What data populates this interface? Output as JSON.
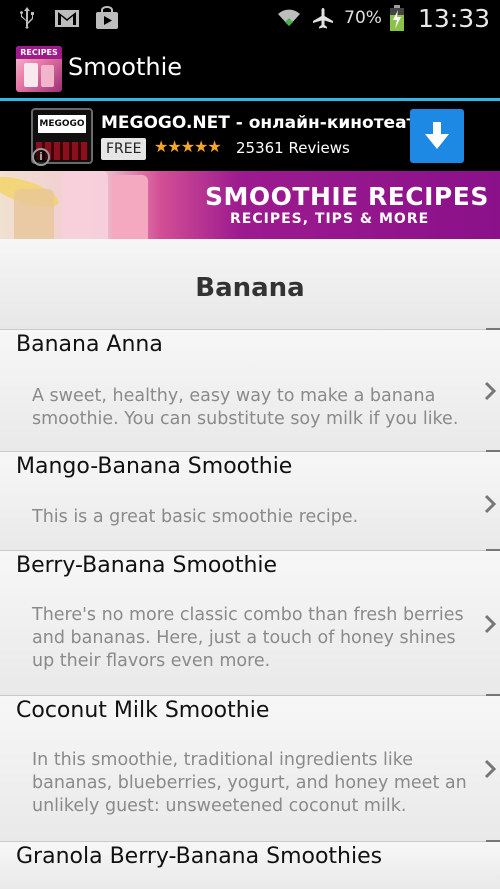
{
  "status_bar": {
    "battery_percent": "70%",
    "time": "13:33",
    "icons": [
      "usb-icon",
      "gmail-icon",
      "play-store-icon",
      "wifi-icon",
      "airplane-icon",
      "battery-charging-icon"
    ]
  },
  "action_bar": {
    "app_icon_tag": "RECIPES",
    "title": "Smoothie"
  },
  "ad": {
    "logo_text": "MEGOGO",
    "title": "MEGOGO.NET - онлайн-кинотеатр",
    "price": "FREE",
    "rating_stars": "★★★★★",
    "reviews": "25361 Reviews"
  },
  "promo": {
    "title": "SMOOTHIE RECIPES",
    "subtitle": "RECIPES, TIPS & MORE"
  },
  "section": {
    "title": "Banana"
  },
  "recipes": [
    {
      "name": "Banana Anna",
      "description": "A sweet, healthy, easy way to make a banana smoothie. You can substitute soy milk if you like."
    },
    {
      "name": "Mango-Banana Smoothie",
      "description": "This is a great basic smoothie recipe."
    },
    {
      "name": "Berry-Banana Smoothie",
      "description": "There's no more classic combo than fresh berries and bananas. Here, just a touch of honey shines up their flavors even more."
    },
    {
      "name": "Coconut Milk Smoothie",
      "description": "In this smoothie, traditional ingredients like bananas, blueberries, yogurt, and honey meet an unlikely guest: unsweetened coconut milk."
    },
    {
      "name": "Granola Berry-Banana Smoothies",
      "description": ""
    }
  ],
  "colors": {
    "accent_line": "#33b5e5",
    "ad_download": "#1e88e5",
    "promo_purple": "#8a118a",
    "star": "#f5a623"
  }
}
